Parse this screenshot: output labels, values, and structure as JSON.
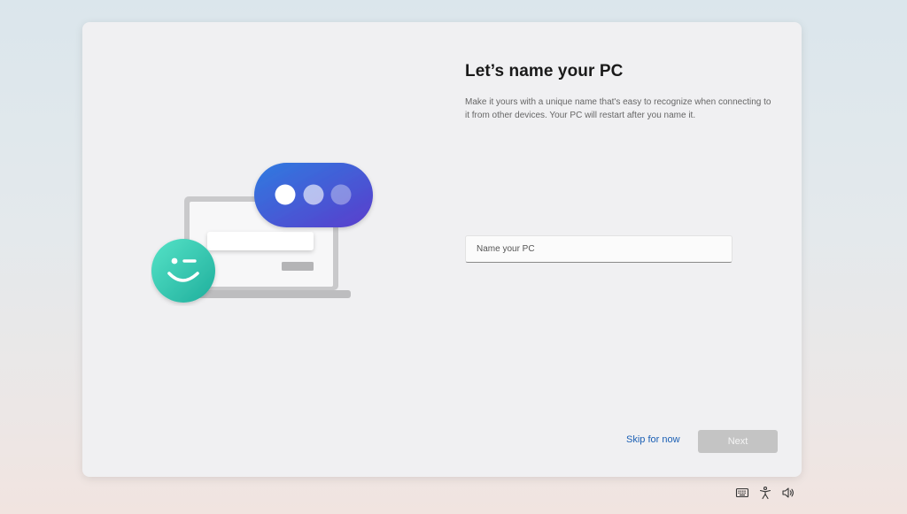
{
  "page": {
    "title": "Let’s name your PC",
    "description": "Make it yours with a unique name that's easy to recognize when connecting to it from other devices. Your PC will restart after you name it."
  },
  "form": {
    "name_placeholder": "Name your PC",
    "name_value": ""
  },
  "actions": {
    "skip_label": "Skip for now",
    "next_label": "Next"
  },
  "illustration": {
    "icons": [
      "laptop-icon",
      "chat-bubble-icon",
      "winking-smiley-icon"
    ]
  },
  "tray": {
    "icons": [
      "keyboard-icon",
      "accessibility-icon",
      "volume-icon"
    ]
  },
  "colors": {
    "accent_link": "#1a5fb4",
    "next_disabled": "#c4c4c4",
    "bubble_gradient": [
      "#2e6fd8",
      "#5b3fd0"
    ],
    "smiley_gradient": [
      "#49dcc0",
      "#22b5a1"
    ]
  }
}
